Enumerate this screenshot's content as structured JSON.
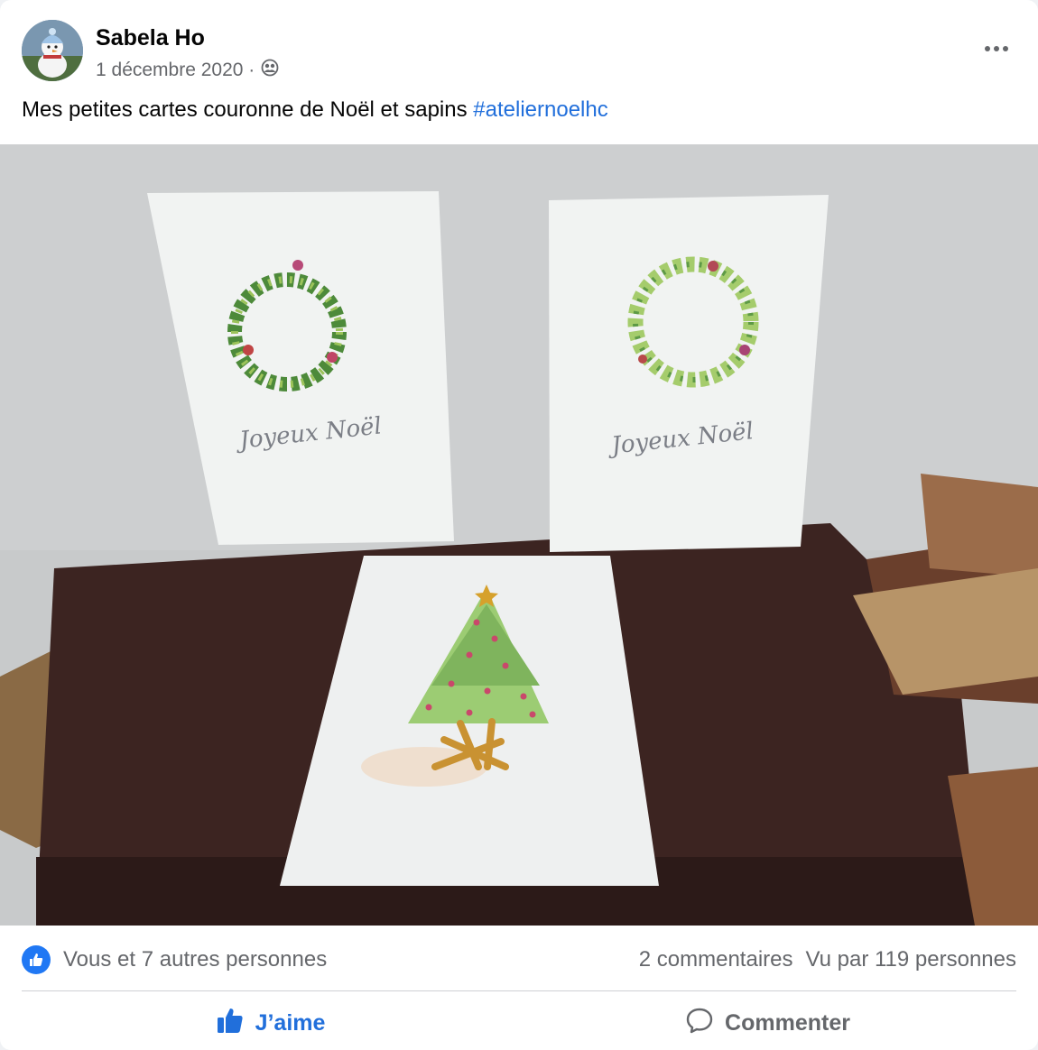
{
  "post": {
    "author": "Sabela Ho",
    "date": "1 décembre 2020 ·",
    "audience_icon": "friends-icon",
    "caption_text": "Mes petites cartes couronne de Noël et sapins ",
    "hashtag": "#ateliernoelhc",
    "photo": {
      "card_left_text": "Joyeux Noël",
      "card_right_text": "Joyeux Noël"
    }
  },
  "stats": {
    "reactions": "Vous et 7 autres personnes",
    "comments": "2 commentaires",
    "views": "Vu par 119 personnes"
  },
  "actions": {
    "like_label": "J’aime",
    "comment_label": "Commenter"
  },
  "colors": {
    "accent": "#216fdb",
    "secondary_text": "#65676b",
    "like_badge": "#2078f4"
  }
}
